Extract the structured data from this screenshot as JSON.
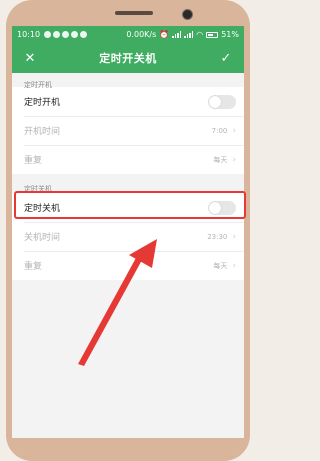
{
  "status_bar": {
    "time": "10:10",
    "network_speed": "0.00K/s",
    "battery": "51%"
  },
  "toolbar": {
    "title": "定时开关机",
    "close_icon": "close-icon",
    "confirm_icon": "check-icon"
  },
  "power_on": {
    "section_label": "定时开机",
    "toggle_label": "定时开机",
    "toggle_on": false,
    "time_label": "开机时间",
    "time_value": "7:00",
    "repeat_label": "重复",
    "repeat_value": "每天"
  },
  "power_off": {
    "section_label": "定时关机",
    "toggle_label": "定时关机",
    "toggle_on": false,
    "time_label": "关机时间",
    "time_value": "23:30",
    "repeat_label": "重复",
    "repeat_value": "每天"
  },
  "annotation_color": "#e53935",
  "accent_color": "#3fac61"
}
